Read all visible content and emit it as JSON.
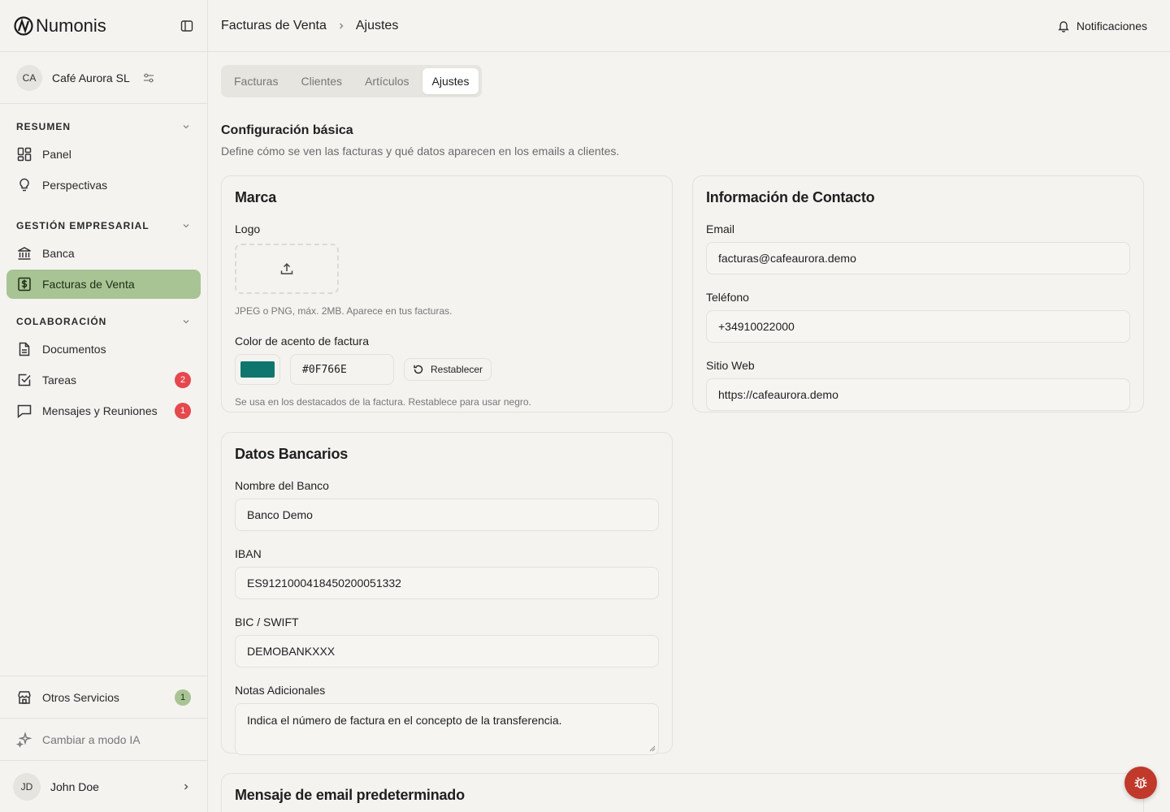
{
  "app": {
    "name": "Numonis"
  },
  "org": {
    "initials": "CA",
    "name": "Café Aurora SL"
  },
  "sidebar": {
    "sections": [
      {
        "title": "RESUMEN",
        "items": [
          {
            "label": "Panel"
          },
          {
            "label": "Perspectivas"
          }
        ]
      },
      {
        "title": "GESTIÓN EMPRESARIAL",
        "items": [
          {
            "label": "Banca"
          },
          {
            "label": "Facturas de Venta",
            "active": true
          }
        ]
      },
      {
        "title": "COLABORACIÓN",
        "items": [
          {
            "label": "Documentos"
          },
          {
            "label": "Tareas",
            "badge": "2"
          },
          {
            "label": "Mensajes y Reuniones",
            "badge": "1"
          }
        ]
      }
    ],
    "other_services": {
      "label": "Otros Servicios",
      "badge": "1"
    },
    "ai_mode": {
      "label": "Cambiar a modo IA"
    },
    "user": {
      "initials": "JD",
      "name": "John Doe"
    }
  },
  "header": {
    "breadcrumb": [
      "Facturas de Venta",
      "Ajustes"
    ],
    "notifications_label": "Notificaciones"
  },
  "tabs": [
    {
      "label": "Facturas"
    },
    {
      "label": "Clientes"
    },
    {
      "label": "Artículos"
    },
    {
      "label": "Ajustes",
      "active": true
    }
  ],
  "page": {
    "title": "Configuración básica",
    "subtitle": "Define cómo se ven las facturas y qué datos aparecen en los emails a clientes."
  },
  "brand_card": {
    "title": "Marca",
    "logo_label": "Logo",
    "logo_hint": "JPEG o PNG, máx. 2MB. Aparece en tus facturas.",
    "accent_label": "Color de acento de factura",
    "accent_color": "#0F766E",
    "accent_hex": "#0F766E",
    "reset_label": "Restablecer",
    "accent_hint": "Se usa en los destacados de la factura. Restablece para usar negro."
  },
  "contact_card": {
    "title": "Información de Contacto",
    "email_label": "Email",
    "email_value": "facturas@cafeaurora.demo",
    "phone_label": "Teléfono",
    "phone_value": "+34910022000",
    "web_label": "Sitio Web",
    "web_value": "https://cafeaurora.demo"
  },
  "bank_card": {
    "title": "Datos Bancarios",
    "bank_name_label": "Nombre del Banco",
    "bank_name_value": "Banco Demo",
    "iban_label": "IBAN",
    "iban_value": "ES9121000418450200051332",
    "bic_label": "BIC / SWIFT",
    "bic_value": "DEMOBANKXXX",
    "notes_label": "Notas Adicionales",
    "notes_value": "Indica el número de factura en el concepto de la transferencia."
  },
  "email_card": {
    "title": "Mensaje de email predeterminado"
  },
  "colors": {
    "active_nav": "#a8c494",
    "badge_red": "#e5484d",
    "fab": "#c0392b"
  }
}
